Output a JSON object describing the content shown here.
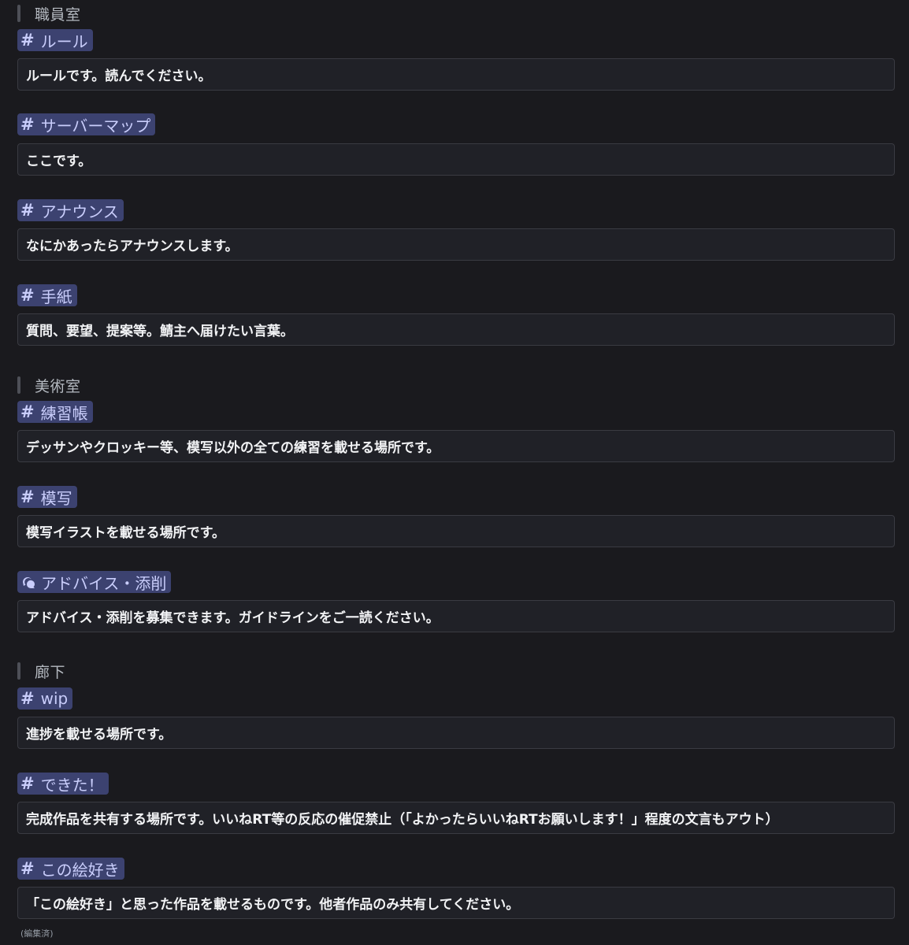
{
  "sections": [
    {
      "heading": "職員室",
      "channels": [
        {
          "icon": "hash-icon",
          "name": "ルール",
          "description": "ルールです。読んでください。"
        },
        {
          "icon": "hash-icon",
          "name": "サーバーマップ",
          "description": "ここです。"
        },
        {
          "icon": "hash-icon",
          "name": "アナウンス",
          "description": "なにかあったらアナウンスします。"
        },
        {
          "icon": "hash-icon",
          "name": "手紙",
          "description": "質問、要望、提案等。鯖主へ届けたい言葉。"
        }
      ]
    },
    {
      "heading": "美術室",
      "channels": [
        {
          "icon": "hash-icon",
          "name": "練習帳",
          "description": "デッサンやクロッキー等、模写以外の全ての練習を載せる場所です。"
        },
        {
          "icon": "hash-icon",
          "name": "模写",
          "description": "模写イラストを載せる場所です。"
        },
        {
          "icon": "forum-icon",
          "name": "アドバイス・添削",
          "description": "アドバイス・添削を募集できます。ガイドラインをご一読ください。"
        }
      ]
    },
    {
      "heading": "廊下",
      "channels": [
        {
          "icon": "hash-icon",
          "name": "wip",
          "description": "進捗を載せる場所です。"
        },
        {
          "icon": "hash-icon",
          "name": "できた！",
          "description": "完成作品を共有する場所です。いいねRT等の反応の催促禁止（「よかったらいいねRTお願いします！」程度の文言もアウト）"
        },
        {
          "icon": "hash-icon",
          "name": "この絵好き",
          "description": "「この絵好き」と思った作品を載せるものです。他者作品のみ共有してください。"
        }
      ]
    }
  ],
  "hash_symbol": "#",
  "edited_label": "(編集済)",
  "colors": {
    "background": "#1a1a1e",
    "mention_bg": "#3c4270",
    "mention_text": "#c9cdfb",
    "box_bg": "#202127",
    "box_border": "#3a3b42"
  }
}
